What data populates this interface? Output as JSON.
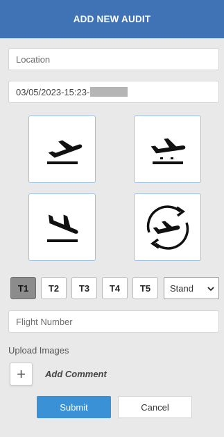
{
  "header": {
    "title": "ADD NEW AUDIT"
  },
  "location": {
    "placeholder": "Location"
  },
  "datetime": {
    "value": "03/05/2023-15:23-"
  },
  "tiles": [
    {
      "icon": "airplane-departure-icon"
    },
    {
      "icon": "airplane-parked-icon"
    },
    {
      "icon": "airplane-arrival-icon"
    },
    {
      "icon": "airplane-turnaround-icon"
    }
  ],
  "terminals": [
    "T1",
    "T2",
    "T3",
    "T4",
    "T5"
  ],
  "terminal_selected": "T1",
  "stand": {
    "selected": "Stand"
  },
  "flight_number": {
    "placeholder": "Flight Number"
  },
  "upload": {
    "label": "Upload Images"
  },
  "comment": {
    "add_symbol": "+",
    "label": "Add Comment"
  },
  "actions": {
    "submit": "Submit",
    "cancel": "Cancel"
  },
  "colors": {
    "header": "#3f73b6",
    "submit": "#3a91d6",
    "tile_border": "#9cc0e8"
  }
}
